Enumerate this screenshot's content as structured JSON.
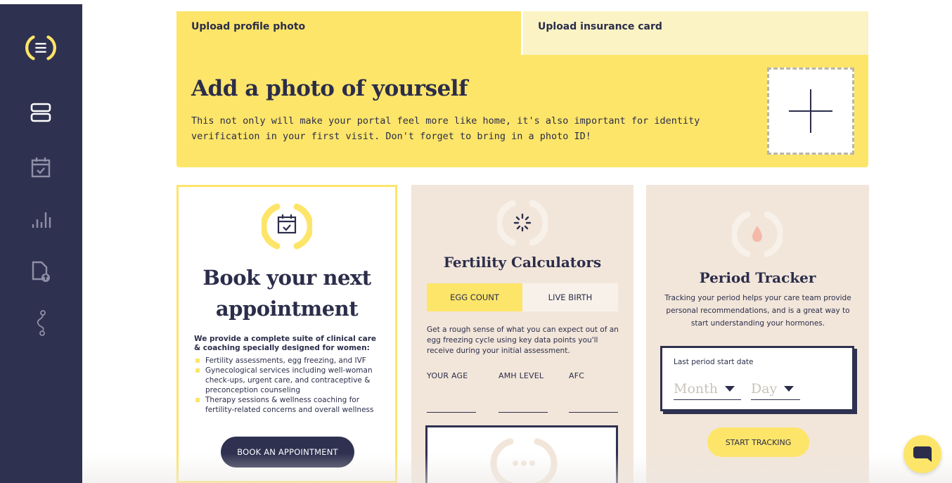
{
  "sidebar": {
    "items": [
      {
        "icon": "logo-icon"
      },
      {
        "icon": "dashboard-icon"
      },
      {
        "icon": "calendar-icon"
      },
      {
        "icon": "chart-icon"
      },
      {
        "icon": "document-upload-icon"
      },
      {
        "icon": "journey-icon"
      }
    ]
  },
  "upload": {
    "tabs": [
      {
        "label": "Upload profile photo",
        "active": true
      },
      {
        "label": "Upload insurance card",
        "active": false
      }
    ],
    "title": "Add a photo of yourself",
    "text": "This not only will make your portal feel more like home, it's also important for identity verification in your first visit. Don't forget to bring in a photo ID!"
  },
  "book": {
    "title_line1": "Book your next",
    "title_line2": "appointment",
    "lead": "We provide a complete suite of clinical care & coaching specially designed for women:",
    "services": [
      "Fertility assessments, egg freezing, and IVF",
      "Gynecological services including well-woman check-ups, urgent care, and contraceptive & preconception counseling",
      "Therapy sessions & wellness coaching for fertility-related concerns and overall wellness"
    ],
    "button_label": "BOOK AN APPOINTMENT"
  },
  "fertility": {
    "title": "Fertility Calculators",
    "toggle": {
      "option1": "EGG COUNT",
      "option2": "LIVE BIRTH"
    },
    "description": "Get a rough sense of what you can expect out of an egg freezing cycle using key data points you'll receive during your initial assessment.",
    "fields": {
      "age": "YOUR AGE",
      "amh": "AMH LEVEL",
      "afc": "AFC"
    }
  },
  "period": {
    "title": "Period Tracker",
    "description": "Tracking your period helps your care team provide personal recommendations, and is a great way to start understanding your hormones.",
    "date_label": "Last period start date",
    "month_placeholder": "Month",
    "day_placeholder": "Day",
    "button_label": "START TRACKING"
  },
  "colors": {
    "sidebar": "#2f3150",
    "accent_yellow": "#fde569",
    "card_beige": "#f2e6da",
    "text_dark": "#2b2d4a"
  }
}
